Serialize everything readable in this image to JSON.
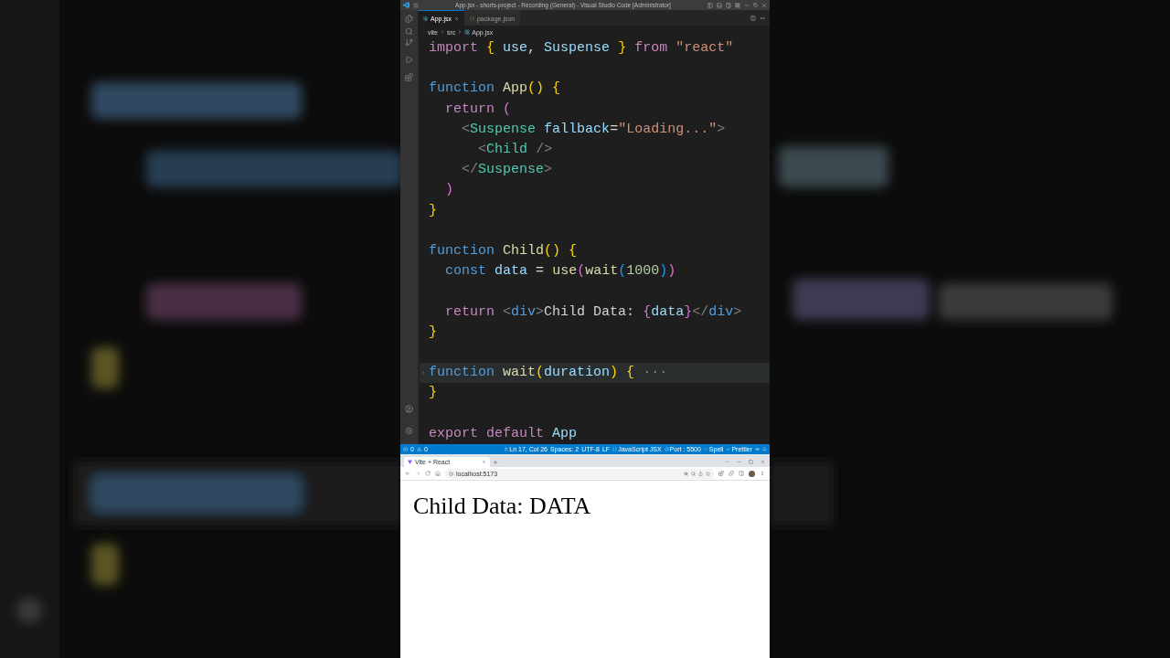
{
  "vscode": {
    "title": "App.jsx - shorts-project - Recording (General) - Visual Studio Code [Administrator]",
    "tabs": [
      {
        "label": "App.jsx",
        "selected": true,
        "kind": "react"
      },
      {
        "label": "package.json",
        "selected": false,
        "kind": "json"
      }
    ],
    "breadcrumb": [
      "vite",
      "src",
      "App.jsx"
    ],
    "code": [
      {
        "text": "import { use, Suspense } from \"react\""
      },
      {
        "text": "function App() {",
        "blank_before": true
      },
      {
        "text": "  return ("
      },
      {
        "text": "    <Suspense fallback=\"Loading...\">"
      },
      {
        "text": "      <Child />"
      },
      {
        "text": "    </Suspense>"
      },
      {
        "text": "  )"
      },
      {
        "text": "}"
      },
      {
        "text": "function Child() {",
        "blank_before": true
      },
      {
        "text": "  const data = use(wait(1000))"
      },
      {
        "text": "  return <div>Child Data: {data}</div>",
        "blank_before": true
      },
      {
        "text": "}"
      },
      {
        "text": "function wait(duration) { ···",
        "blank_before": true,
        "folded": true
      },
      {
        "text": "}"
      },
      {
        "text": "export default App",
        "blank_before": true
      }
    ],
    "status_bar": {
      "errors": "0",
      "warnings": "0",
      "items": [
        "Ln 17, Col 26",
        "Spaces: 2",
        "UTF-8",
        "LF",
        "JavaScript JSX",
        "Port : 5500",
        "Spell",
        "Prettier"
      ]
    }
  },
  "browser": {
    "tabs": [
      {
        "label": "Vite + React",
        "selected": true
      }
    ],
    "address": "localhost:5173",
    "page_text": "Child Data: DATA"
  }
}
